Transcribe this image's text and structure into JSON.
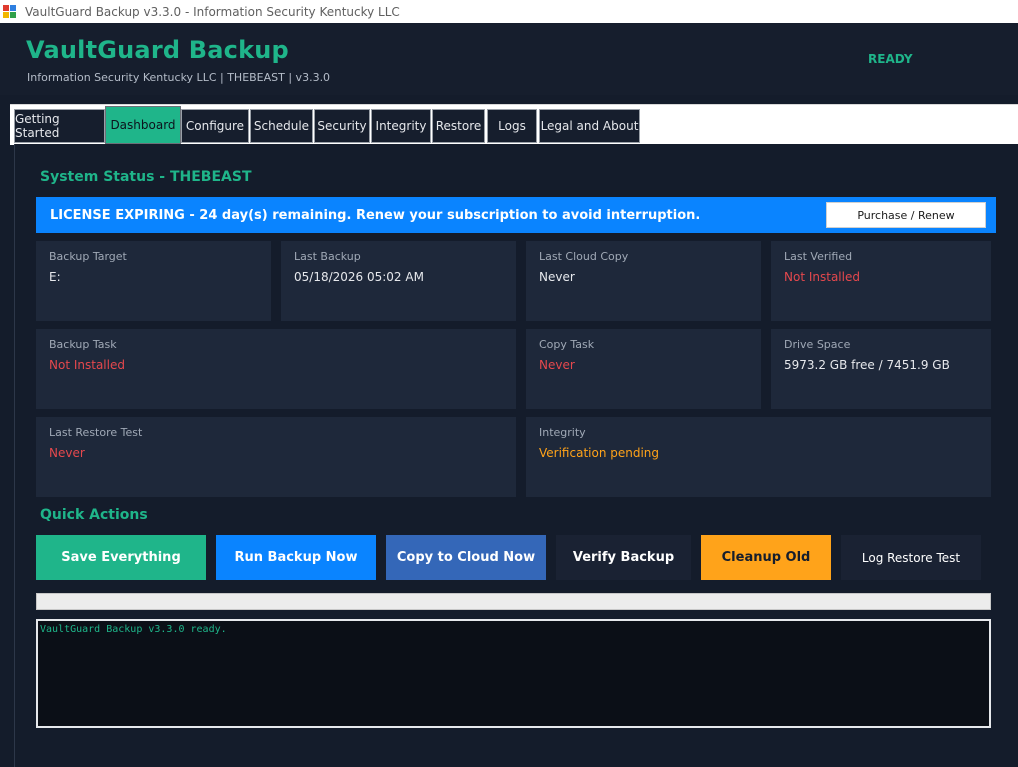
{
  "window": {
    "title": "VaultGuard Backup v3.3.0  -  Information Security Kentucky LLC"
  },
  "header": {
    "app_name": "VaultGuard Backup",
    "subtitle": "Information Security Kentucky LLC  |  THEBEAST  |  v3.3.0",
    "status": "READY"
  },
  "tabs": [
    {
      "label": "Getting Started"
    },
    {
      "label": "Dashboard",
      "active": true
    },
    {
      "label": "Configure"
    },
    {
      "label": "Schedule"
    },
    {
      "label": "Security"
    },
    {
      "label": "Integrity"
    },
    {
      "label": "Restore"
    },
    {
      "label": "Logs"
    },
    {
      "label": "Legal and About"
    }
  ],
  "dashboard": {
    "system_status_title": "System Status  -  THEBEAST",
    "license_banner": "LICENSE EXPIRING - 24 day(s) remaining. Renew your subscription to avoid interruption.",
    "renew_button": "Purchase / Renew",
    "cards": {
      "backup_target": {
        "label": "Backup Target",
        "value": "E:"
      },
      "last_backup": {
        "label": "Last Backup",
        "value": "05/18/2026 05:02 AM"
      },
      "last_cloud_copy": {
        "label": "Last Cloud Copy",
        "value": "Never"
      },
      "last_verified": {
        "label": "Last Verified",
        "value": "Not Installed"
      },
      "backup_task": {
        "label": "Backup Task",
        "value": "Not Installed"
      },
      "copy_task": {
        "label": "Copy Task",
        "value": "Never"
      },
      "drive_space": {
        "label": "Drive Space",
        "value": "5973.2 GB free / 7451.9 GB"
      },
      "last_restore_test": {
        "label": "Last Restore Test",
        "value": "Never"
      },
      "integrity": {
        "label": "Integrity",
        "value": "Verification pending"
      }
    },
    "quick_actions_title": "Quick Actions",
    "actions": {
      "save_everything": "Save Everything",
      "run_backup": "Run Backup Now",
      "copy_to_cloud": "Copy to Cloud Now",
      "verify_backup": "Verify Backup",
      "cleanup_old": "Cleanup Old",
      "log_restore_test": "Log Restore Test"
    },
    "progress_fraction": 0,
    "console_text": "VaultGuard Backup v3.3.0 ready."
  },
  "colors": {
    "accent": "#1fb58a",
    "banner": "#0a84ff",
    "danger": "#e5484d",
    "warning": "#ffa31a",
    "copy_button": "#3467b8"
  }
}
